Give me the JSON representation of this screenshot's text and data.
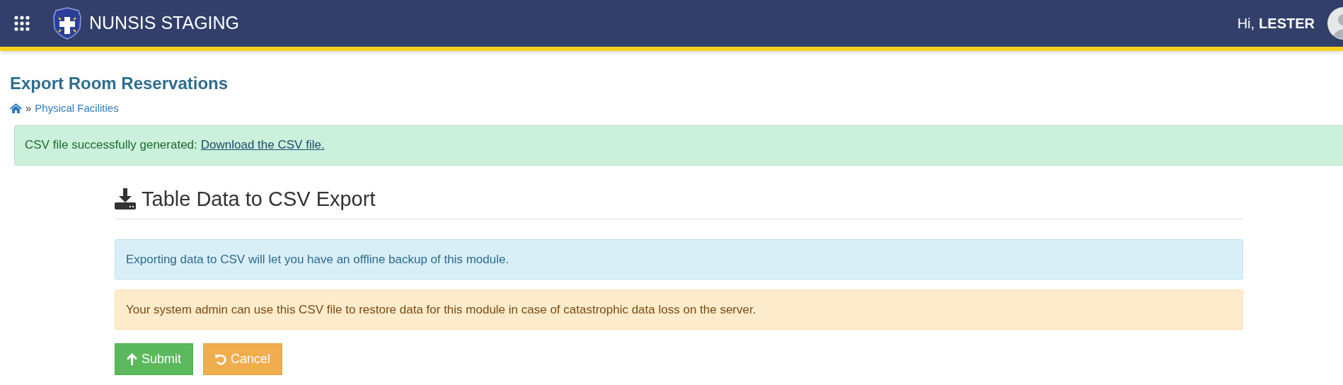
{
  "header": {
    "app_title": "NUNSIS STAGING",
    "greeting": "Hi,",
    "user_name": "LESTER"
  },
  "page": {
    "title": "Export Room Reservations",
    "breadcrumb": [
      {
        "kind": "home"
      },
      {
        "kind": "separator",
        "label": "»"
      },
      {
        "kind": "link",
        "label": "Physical Facilities"
      }
    ]
  },
  "success_alert": {
    "text": "CSV file successfully generated:",
    "link": "Download the CSV file."
  },
  "panel": {
    "heading": "Table Data to CSV Export",
    "notes": [
      {
        "kind": "info",
        "text": "Exporting data to CSV will let you have an offline backup of this module."
      },
      {
        "kind": "warning",
        "text": "Your system admin can use this CSV file to restore data for this module in case of catastrophic data loss on the server."
      }
    ],
    "buttons": [
      {
        "kind": "submit",
        "label": "Submit"
      },
      {
        "kind": "cancel",
        "label": "Cancel"
      }
    ]
  }
}
